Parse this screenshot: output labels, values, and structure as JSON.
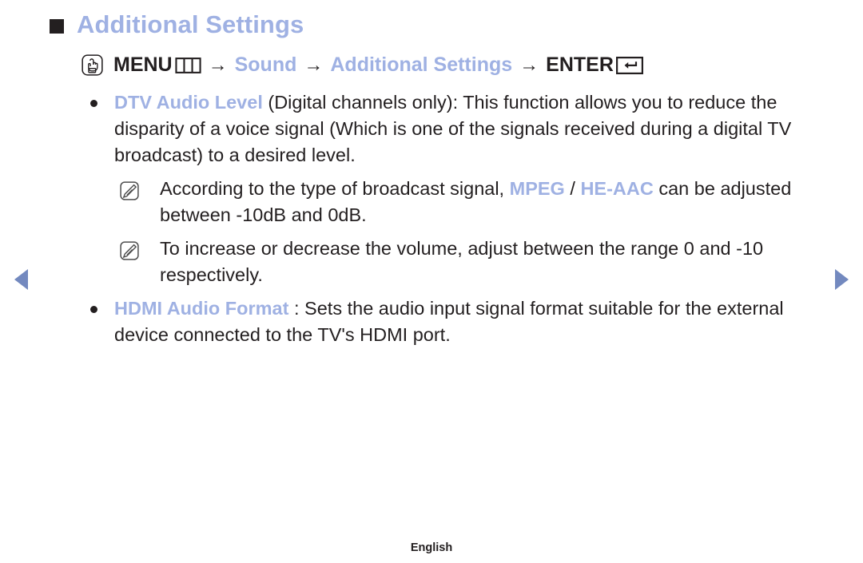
{
  "page": {
    "title": "Additional Settings",
    "title_color": "#9fb1e3",
    "text_color": "#231f20",
    "background": "#ffffff"
  },
  "menu_path": {
    "remote_icon": "remote-touch-icon",
    "menu_label": "MENU",
    "menu_grid_icon": "menu-grid-icon",
    "arrow1": "→",
    "sound_label": "Sound",
    "arrow2": "→",
    "additional_settings_label": "Additional Settings",
    "arrow3": "→",
    "enter_label": "ENTER",
    "enter_icon": "enter-return-icon"
  },
  "items": [
    {
      "type": "bullet",
      "term": "DTV Audio Level",
      "body": " (Digital channels only): This function allows you to reduce the disparity of a voice signal (Which is one of the signals received during a digital TV broadcast) to a desired level."
    },
    {
      "type": "note",
      "pre": "According to the type of broadcast signal, ",
      "hl1": "MPEG",
      "mid": " / ",
      "hl2": "HE-AAC",
      "post": " can be adjusted between -10dB and 0dB."
    },
    {
      "type": "note",
      "pre": "To increase or decrease the volume, adjust between the range 0 and -10 respectively.",
      "hl1": "",
      "mid": "",
      "hl2": "",
      "post": ""
    },
    {
      "type": "bullet",
      "term": "HDMI Audio Format",
      "body": " : Sets the audio input signal format suitable for the external device connected to the TV's HDMI port."
    }
  ],
  "nav": {
    "prev_icon": "previous-page-arrow-icon",
    "next_icon": "next-page-arrow-icon",
    "arrow_color": "#7389bf"
  },
  "footer": {
    "language": "English"
  }
}
